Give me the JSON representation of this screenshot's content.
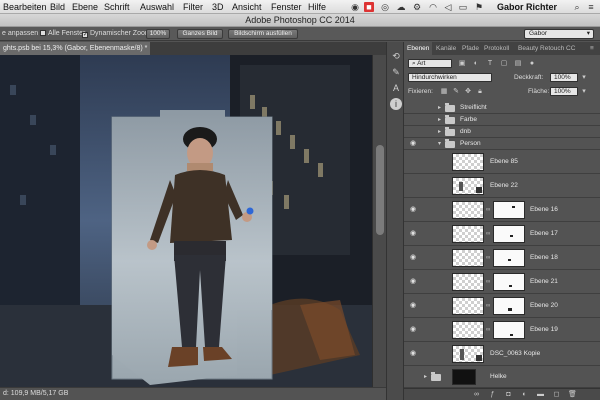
{
  "menubar": {
    "items": [
      "Bearbeiten",
      "Bild",
      "Ebene",
      "Schrift",
      "Auswahl",
      "Filter",
      "3D",
      "Ansicht",
      "Fenster",
      "Hilfe"
    ],
    "user": "Gabor Richter"
  },
  "app_title": "Adobe Photoshop CC 2014",
  "options": {
    "fit_label": "e anpassen",
    "all_windows": "Alle Fenster",
    "dynamic_zoom": "Dynamischer Zoom",
    "btn_100": "100%",
    "btn_whole": "Ganzes Bild",
    "btn_fill": "Bildschirm ausfüllen",
    "preset": "Gabor"
  },
  "document": {
    "tab": "ghts.psb bei 15,3% (Gabor, Ebenenmaske/8) *"
  },
  "status": "d: 109,9 MB/5,17 GB",
  "panel": {
    "tabs": [
      "Ebenen",
      "Kanäle",
      "Pfade",
      "Protokoll",
      "Beauty Retouch CC"
    ],
    "filter_kind": "Art",
    "blend_mode": "Hindurchwirken",
    "opacity_label": "Deckkraft:",
    "opacity_value": "100%",
    "lock_label": "Fixieren:",
    "fill_label": "Fläche:",
    "fill_value": "100%"
  },
  "layers": [
    {
      "name": "Streiflicht",
      "type": "group",
      "visible": false
    },
    {
      "name": "Farbe",
      "type": "group",
      "visible": false
    },
    {
      "name": "dnb",
      "type": "group",
      "visible": false
    },
    {
      "name": "Person",
      "type": "group-open",
      "visible": true
    },
    {
      "name": "Ebene 85",
      "type": "pixel",
      "visible": false
    },
    {
      "name": "Ebene 22",
      "type": "smart",
      "visible": false
    },
    {
      "name": "Ebene 16",
      "type": "masked",
      "visible": true
    },
    {
      "name": "Ebene 17",
      "type": "masked",
      "visible": true
    },
    {
      "name": "Ebene 18",
      "type": "masked",
      "visible": true
    },
    {
      "name": "Ebene 21",
      "type": "masked",
      "visible": true
    },
    {
      "name": "Ebene 20",
      "type": "masked",
      "visible": true
    },
    {
      "name": "Ebene 19",
      "type": "masked",
      "visible": true
    },
    {
      "name": "DSC_0063 Kopie",
      "type": "smart",
      "visible": true
    },
    {
      "name": "Helke",
      "type": "group",
      "visible": false
    }
  ],
  "icons": {
    "eye": "eye-icon",
    "folder": "folder-icon",
    "chain": "link-icon"
  }
}
